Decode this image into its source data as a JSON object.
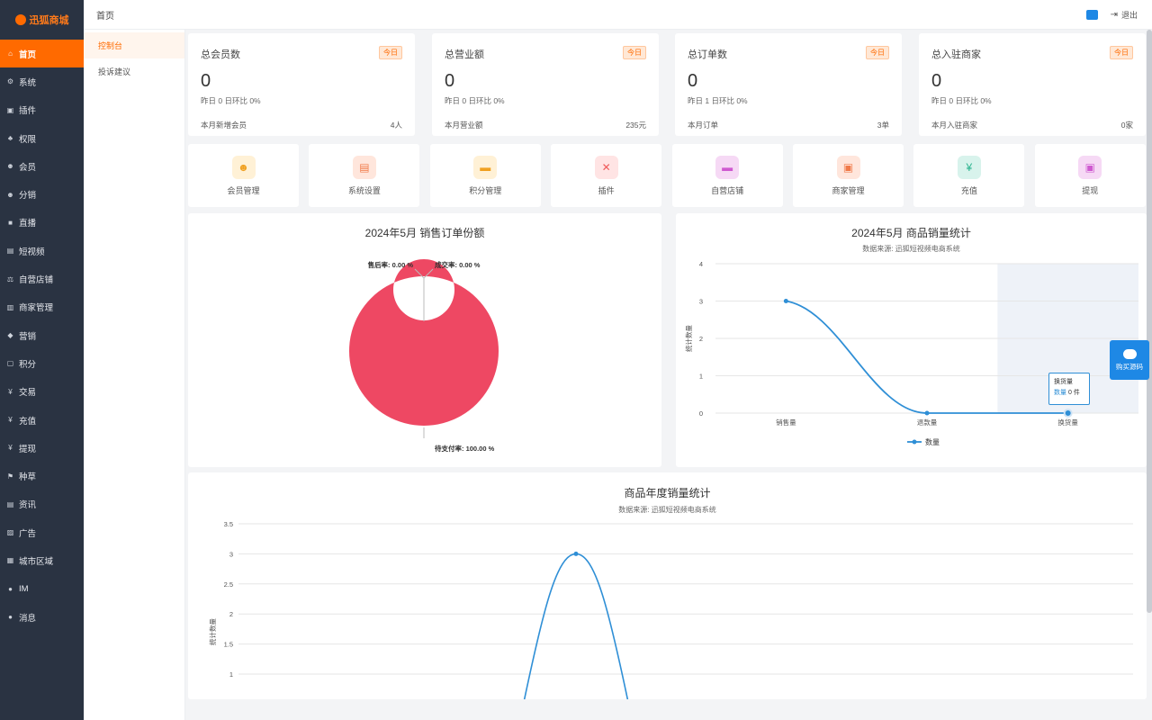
{
  "brand": {
    "name": "迅狐商城"
  },
  "sidebar": {
    "items": [
      {
        "label": "首页",
        "icon": "home-icon",
        "glyph": "⌂",
        "active": true
      },
      {
        "label": "系统",
        "icon": "gear-icon",
        "glyph": "⚙"
      },
      {
        "label": "插件",
        "icon": "plugin-icon",
        "glyph": "▣"
      },
      {
        "label": "权限",
        "icon": "org-icon",
        "glyph": "♣"
      },
      {
        "label": "会员",
        "icon": "users-icon",
        "glyph": "☻"
      },
      {
        "label": "分销",
        "icon": "share-icon",
        "glyph": "☻"
      },
      {
        "label": "直播",
        "icon": "camera-icon",
        "glyph": "■"
      },
      {
        "label": "短视频",
        "icon": "video-icon",
        "glyph": "▤"
      },
      {
        "label": "自营店铺",
        "icon": "scale-icon",
        "glyph": "⚖"
      },
      {
        "label": "商家管理",
        "icon": "bank-icon",
        "glyph": "▥"
      },
      {
        "label": "营销",
        "icon": "tag-icon",
        "glyph": "◆"
      },
      {
        "label": "积分",
        "icon": "doc-icon",
        "glyph": "▢"
      },
      {
        "label": "交易",
        "icon": "yen-icon",
        "glyph": "¥"
      },
      {
        "label": "充值",
        "icon": "yen-icon",
        "glyph": "¥"
      },
      {
        "label": "提现",
        "icon": "yen-icon",
        "glyph": "¥"
      },
      {
        "label": "种草",
        "icon": "flag-icon",
        "glyph": "⚑"
      },
      {
        "label": "资讯",
        "icon": "news-icon",
        "glyph": "▤"
      },
      {
        "label": "广告",
        "icon": "image-icon",
        "glyph": "▨"
      },
      {
        "label": "城市区域",
        "icon": "building-icon",
        "glyph": "▦"
      },
      {
        "label": "IM",
        "icon": "chat-icon",
        "glyph": "●"
      },
      {
        "label": "消息",
        "icon": "comment-icon",
        "glyph": "●"
      }
    ]
  },
  "topbar": {
    "breadcrumb": "首页",
    "logout": "退出"
  },
  "subnav": {
    "items": [
      {
        "label": "控制台",
        "active": true
      },
      {
        "label": "投诉建议"
      }
    ]
  },
  "stats": [
    {
      "title": "总会员数",
      "badge": "今日",
      "value": "0",
      "sub": "昨日 0   日环比 0%",
      "footer_label": "本月新增会员",
      "footer_value": "4人"
    },
    {
      "title": "总营业额",
      "badge": "今日",
      "value": "0",
      "sub": "昨日 0 日环比 0%",
      "footer_label": "本月营业额",
      "footer_value": "235元"
    },
    {
      "title": "总订单数",
      "badge": "今日",
      "value": "0",
      "sub": "昨日 1 日环比 0%",
      "footer_label": "本月订单",
      "footer_value": "3单"
    },
    {
      "title": "总入驻商家",
      "badge": "今日",
      "value": "0",
      "sub": "昨日 0 日环比 0%",
      "footer_label": "本月入驻商家",
      "footer_value": "0家"
    }
  ],
  "quick": [
    {
      "label": "会员管理",
      "icon": "member-icon",
      "glyph": "☻",
      "bg": "#fff1d6",
      "fg": "#f0a020"
    },
    {
      "label": "系统设置",
      "icon": "settings-icon",
      "glyph": "▤",
      "bg": "#ffe6dc",
      "fg": "#f07a4a"
    },
    {
      "label": "积分管理",
      "icon": "points-icon",
      "glyph": "▬",
      "bg": "#fff1d6",
      "fg": "#f0a020"
    },
    {
      "label": "插件",
      "icon": "plugin-icon",
      "glyph": "✕",
      "bg": "#ffe4e4",
      "fg": "#ef5a5a"
    },
    {
      "label": "自营店铺",
      "icon": "store-icon",
      "glyph": "▬",
      "bg": "#f6d9f5",
      "fg": "#cf5ad0"
    },
    {
      "label": "商家管理",
      "icon": "merchant-icon",
      "glyph": "▣",
      "bg": "#ffe6dc",
      "fg": "#f07a4a"
    },
    {
      "label": "充值",
      "icon": "recharge-icon",
      "glyph": "¥",
      "bg": "#d8f3ec",
      "fg": "#2bb48f"
    },
    {
      "label": "提现",
      "icon": "withdraw-icon",
      "glyph": "▣",
      "bg": "#f6d9f5",
      "fg": "#cf5ad0"
    }
  ],
  "float_button": {
    "label": "购买源码"
  },
  "chart_data": [
    {
      "type": "pie",
      "title": "2024年5月 销售订单份额",
      "slices": [
        {
          "name": "售后率",
          "value": 0.0,
          "label": "售后率: 0.00 %"
        },
        {
          "name": "成交率",
          "value": 0.0,
          "label": "成交率: 0.00 %"
        },
        {
          "name": "待支付率",
          "value": 100.0,
          "label": "待支付率: 100.00 %"
        }
      ],
      "color": "#ee4863"
    },
    {
      "type": "line",
      "title": "2024年5月 商品销量统计",
      "subtitle": "数据来源: 迅狐短视频电商系统",
      "ylabel": "统计数量",
      "categories": [
        "销售量",
        "退款量",
        "换货量"
      ],
      "series": [
        {
          "name": "数量",
          "values": [
            3,
            0,
            0
          ]
        }
      ],
      "ylim": [
        0,
        4
      ],
      "yticks": [
        "0",
        "1",
        "2",
        "3",
        "4"
      ],
      "legend": "bottom",
      "tooltip": {
        "title": "换货量",
        "series": "数量",
        "value": "0 件"
      },
      "color": "#2f8fd6"
    },
    {
      "type": "line",
      "title": "商品年度销量统计",
      "subtitle": "数据来源: 迅狐短视频电商系统",
      "ylabel": "统计数量",
      "yticks": [
        "1",
        "1.5",
        "2",
        "2.5",
        "3",
        "3.5"
      ],
      "ylim": [
        1,
        3.5
      ],
      "peak": 3,
      "color": "#2f8fd6"
    }
  ]
}
